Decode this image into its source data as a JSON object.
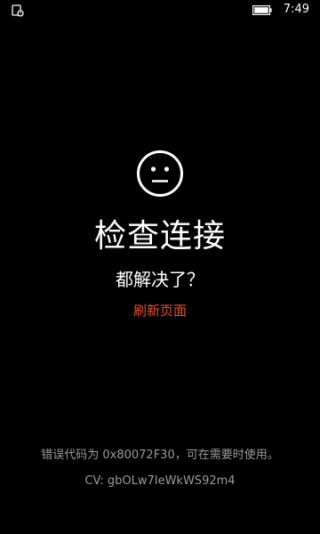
{
  "status_bar": {
    "left_icon": "notification-icon",
    "battery_icon": "battery-icon",
    "time": "7:49"
  },
  "main": {
    "face_icon": "neutral-face-icon",
    "title": "检查连接",
    "subtitle": "都解决了？",
    "refresh_label": "刷新页面",
    "error_code_text": "错误代码为 0x80072F30，可在需要时使用。",
    "cv_text": "CV: gbOLw7IeWkWS92m4"
  },
  "colors": {
    "background": "#000000",
    "accent": "#e8502b",
    "muted_text": "#9a9a9a"
  }
}
